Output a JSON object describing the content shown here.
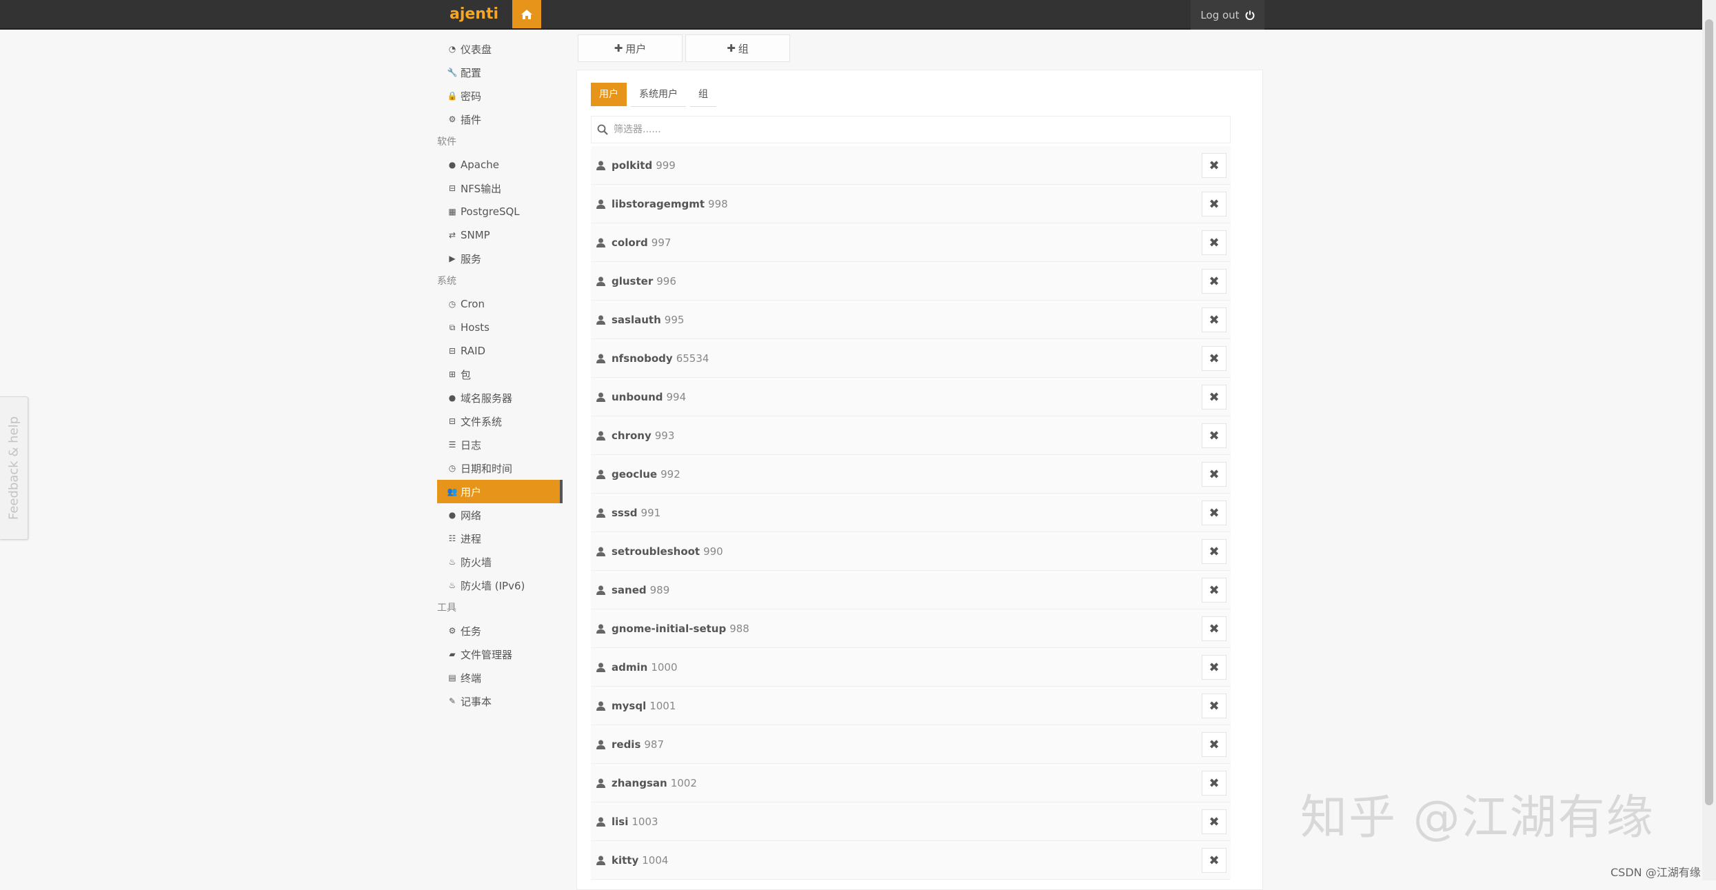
{
  "header": {
    "brand": "ajenti",
    "home_icon": "home-icon",
    "logout_label": "Log out",
    "logout_icon": "power-icon",
    "accent_color": "#e6941a"
  },
  "sidebar": {
    "top_items": [
      {
        "label": "仪表盘",
        "icon": "dashboard-icon"
      },
      {
        "label": "配置",
        "icon": "wrench-icon"
      },
      {
        "label": "密码",
        "icon": "lock-icon"
      },
      {
        "label": "插件",
        "icon": "cogs-icon"
      }
    ],
    "section_software": "软件",
    "software_items": [
      {
        "label": "Apache",
        "icon": "globe-icon"
      },
      {
        "label": "NFS输出",
        "icon": "hdd-icon"
      },
      {
        "label": "PostgreSQL",
        "icon": "table-icon"
      },
      {
        "label": "SNMP",
        "icon": "exchange-icon"
      },
      {
        "label": "服务",
        "icon": "play-icon"
      }
    ],
    "section_system": "系统",
    "system_items": [
      {
        "label": "Cron",
        "icon": "clock-icon"
      },
      {
        "label": "Hosts",
        "icon": "sitemap-icon"
      },
      {
        "label": "RAID",
        "icon": "hdd-icon"
      },
      {
        "label": "包",
        "icon": "gift-icon"
      },
      {
        "label": "域名服务器",
        "icon": "globe-icon"
      },
      {
        "label": "文件系统",
        "icon": "hdd-icon"
      },
      {
        "label": "日志",
        "icon": "list-icon"
      },
      {
        "label": "日期和时间",
        "icon": "clock-icon"
      },
      {
        "label": "用户",
        "icon": "group-icon"
      },
      {
        "label": "网络",
        "icon": "globe-icon"
      },
      {
        "label": "进程",
        "icon": "th-list-icon"
      },
      {
        "label": "防火墙",
        "icon": "fire-icon"
      },
      {
        "label": "防火墙 (IPv6)",
        "icon": "fire-icon"
      }
    ],
    "section_tools": "工具",
    "tools_items": [
      {
        "label": "任务",
        "icon": "cog-icon"
      },
      {
        "label": "文件管理器",
        "icon": "folder-open-icon"
      },
      {
        "label": "终端",
        "icon": "terminal-icon"
      },
      {
        "label": "记事本",
        "icon": "edit-icon"
      }
    ],
    "active_label": "用户"
  },
  "feedback_label": "Feedback & help",
  "actions": {
    "add_user": "用户",
    "add_group": "组"
  },
  "tabs": [
    "用户",
    "系统用户",
    "组"
  ],
  "filter": {
    "placeholder": "筛选器......"
  },
  "users": [
    {
      "name": "polkitd",
      "uid": "999"
    },
    {
      "name": "libstoragemgmt",
      "uid": "998"
    },
    {
      "name": "colord",
      "uid": "997"
    },
    {
      "name": "gluster",
      "uid": "996"
    },
    {
      "name": "saslauth",
      "uid": "995"
    },
    {
      "name": "nfsnobody",
      "uid": "65534"
    },
    {
      "name": "unbound",
      "uid": "994"
    },
    {
      "name": "chrony",
      "uid": "993"
    },
    {
      "name": "geoclue",
      "uid": "992"
    },
    {
      "name": "sssd",
      "uid": "991"
    },
    {
      "name": "setroubleshoot",
      "uid": "990"
    },
    {
      "name": "saned",
      "uid": "989"
    },
    {
      "name": "gnome-initial-setup",
      "uid": "988"
    },
    {
      "name": "admin",
      "uid": "1000"
    },
    {
      "name": "mysql",
      "uid": "1001"
    },
    {
      "name": "redis",
      "uid": "987"
    },
    {
      "name": "zhangsan",
      "uid": "1002"
    },
    {
      "name": "lisi",
      "uid": "1003"
    },
    {
      "name": "kitty",
      "uid": "1004"
    }
  ],
  "watermark": "知乎 @江湖有缘",
  "csdn_credit": "CSDN @江湖有缘"
}
